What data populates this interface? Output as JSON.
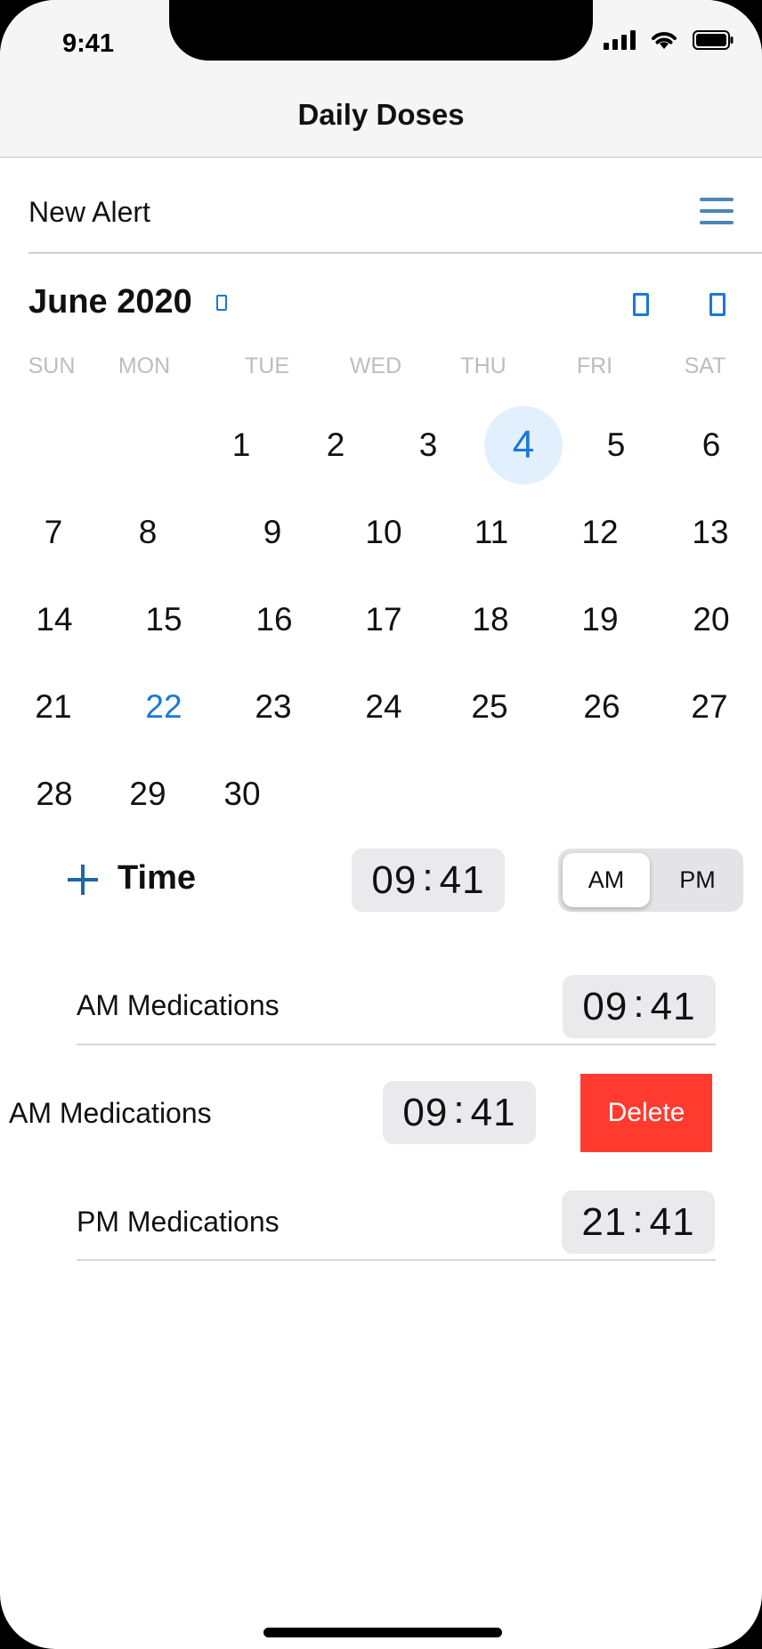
{
  "status_bar": {
    "time": "9:41"
  },
  "nav": {
    "title": "Daily Doses"
  },
  "alert": {
    "label": "New Alert"
  },
  "calendar": {
    "month_year": "June 2020",
    "weekdays": [
      "SUN",
      "MON",
      "TUE",
      "WED",
      "THU",
      "FRI",
      "SAT"
    ],
    "days": [
      "1",
      "2",
      "3",
      "4",
      "5",
      "6",
      "7",
      "8",
      "9",
      "10",
      "11",
      "12",
      "13",
      "14",
      "15",
      "16",
      "17",
      "18",
      "19",
      "20",
      "21",
      "22",
      "23",
      "24",
      "25",
      "26",
      "27",
      "28",
      "29",
      "30"
    ],
    "selected_day": "4",
    "highlighted_day": "22"
  },
  "time_picker": {
    "label": "Time",
    "hour": "09",
    "minute": "41",
    "am_label": "AM",
    "pm_label": "PM",
    "selected_period": "AM"
  },
  "medications": [
    {
      "label": "AM Medications",
      "hour": "09",
      "minute": "41"
    },
    {
      "label": "AM Medications",
      "hour": "09",
      "minute": "41",
      "delete_label": "Delete"
    },
    {
      "label": "PM Medications",
      "hour": "21",
      "minute": "41"
    }
  ],
  "colors": {
    "accent": "#1b78d8",
    "delete": "#ff3b30",
    "today_bg": "#e2effd",
    "menu_icon": "#4a86b8"
  }
}
